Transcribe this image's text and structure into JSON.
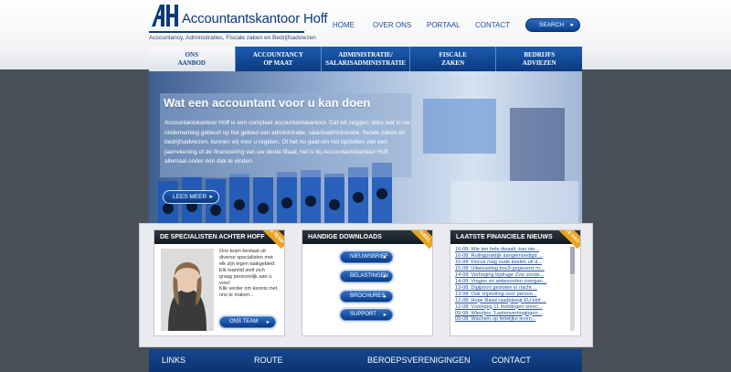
{
  "header": {
    "logo_text": "Accountantskantoor Hoff",
    "tagline": "Accountancy, Administraties, Fiscale zaken en Bedrijfsadviezen",
    "nav": [
      "HOME",
      "OVER ONS",
      "PORTAAL",
      "CONTACT"
    ],
    "search_label": "SEARCH"
  },
  "mainnav": [
    {
      "line1": "ONS",
      "line2": "AANBOD"
    },
    {
      "line1": "ACCOUNTANCY",
      "line2": "OP MAAT"
    },
    {
      "line1": "ADMINISTRATIE/",
      "line2": "SALARISADMINISTRATIE"
    },
    {
      "line1": "FISCALE",
      "line2": "ZAKEN"
    },
    {
      "line1": "BEDRIJFS",
      "line2": "ADVIEZEN"
    }
  ],
  "hero": {
    "title": "Wat een accountant voor u kan doen",
    "text": "Accountantskantoor Hoff is een compleet accountantskantoor. Dat wil zeggen: alles wat in uw onderneming gebeurt op het gebied van administratie, salarisadministratie, fiscale zaken en bedrijfsadviezen, kunnen wij voor u regelen. Of het nu gaat om het opstellen van een jaarrekening of de financiering van uw derde filiaal, het is bij Accountantskantoor Hoff allemaal onder één dak te vinden.",
    "button": "LEES MEER"
  },
  "panels": {
    "team": {
      "title": "DE SPECIALISTEN ACHTER HOFF",
      "ribbon": "ONS TEAM",
      "text1": "Ons team bestaat uit diverse specialisten met elk zijn eigen taakgebied. Elk teamlid stelt zich graag persoonlijk aan u voor!",
      "text2": "Klik verder om kennis met ons te maken...",
      "button": "ONS TEAM"
    },
    "downloads": {
      "title": "HANDIGE DOWNLOADS",
      "ribbon": "AKTUEEL",
      "buttons": [
        "NIEUWSBRIEF",
        "BELASTINGEN",
        "BROCHURES",
        "SUPPORT"
      ]
    },
    "news": {
      "title": "LAATSTE FINANCIELE NIEUWS",
      "ribbon": "ELKE DAG",
      "items": [
        "16-08: Wie ten hele dwaalt, kan nie...",
        "16-08: Rulingpraktijk aangemoedigd ...",
        "15-08: Fiscus mag oude koelen uit d...",
        "15-08: Uitwisseling box3-gegevens m...",
        "14-08: Verhoging bijdrage Zvw zonde...",
        "14-08: Vragen en antwoorden overgan...",
        "13-08: Digipoort gesloten in nacht ...",
        "13-08: Ook vrijstelling voor person...",
        "12-08: Hoge Raad raadpleegt EU-Hof ...",
        "12-08: Voorlopig 11 meldingen onrec...",
        "09-08: Wientjes: 'Lastenverhogingen...",
        "09-08: Wachten op feitelijke leveri..."
      ]
    }
  },
  "footer": [
    "LINKS",
    "ROUTE",
    "BEROEPSVERENIGINGEN",
    "CONTACT"
  ],
  "colors": {
    "brand": "#0c3a78",
    "nav_blue": "#1c5bb0",
    "ribbon": "#e8a320",
    "page_bg": "#4a5058"
  }
}
